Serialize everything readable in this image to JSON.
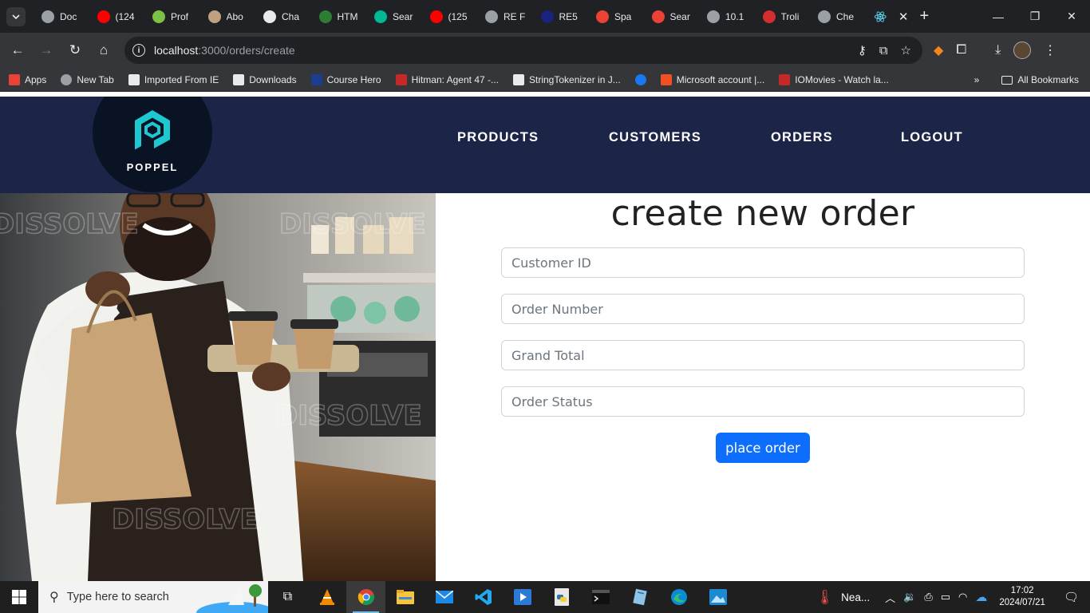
{
  "browser": {
    "tabs": [
      {
        "title": "Doc",
        "icon": "globe-icon",
        "color": "#9aa0a6"
      },
      {
        "title": "(124",
        "icon": "youtube-icon",
        "color": "#ff0000"
      },
      {
        "title": "Prof",
        "icon": "pen-icon",
        "color": "#7cc242"
      },
      {
        "title": "Abo",
        "icon": "avatar-icon",
        "color": "#c0a080"
      },
      {
        "title": "Cha",
        "icon": "chatgpt-icon",
        "color": "#e8eaed"
      },
      {
        "title": "HTM",
        "icon": "w-icon",
        "color": "#2e7d32"
      },
      {
        "title": "Sear",
        "icon": "v-icon",
        "color": "#00b894"
      },
      {
        "title": "(125",
        "icon": "youtube-icon",
        "color": "#ff0000"
      },
      {
        "title": "RE F",
        "icon": "globe-icon",
        "color": "#9aa0a6"
      },
      {
        "title": "RE5",
        "icon": "square-icon",
        "color": "#1a237e"
      },
      {
        "title": "Spa",
        "icon": "gmail-icon",
        "color": "#ea4335"
      },
      {
        "title": "Sear",
        "icon": "gmail-icon",
        "color": "#ea4335"
      },
      {
        "title": "10.1",
        "icon": "globe-icon",
        "color": "#9aa0a6"
      },
      {
        "title": "Troli",
        "icon": "shield-icon",
        "color": "#d32f2f"
      },
      {
        "title": "Che",
        "icon": "globe-icon",
        "color": "#9aa0a6"
      }
    ],
    "url_host": "localhost",
    "url_path": ":3000/orders/create",
    "bookmarks": [
      {
        "label": "Apps",
        "icon": "apps-grid-icon",
        "color": "#ea4335"
      },
      {
        "label": "New Tab",
        "icon": "globe-icon",
        "color": "#9aa0a6"
      },
      {
        "label": "Imported From IE",
        "icon": "folder-icon",
        "color": "#e8eaed"
      },
      {
        "label": "Downloads",
        "icon": "download-icon",
        "color": "#e8eaed"
      },
      {
        "label": "Course Hero",
        "icon": "star-icon",
        "color": "#1a3d8f"
      },
      {
        "label": "Hitman: Agent 47 -...",
        "icon": "io-icon",
        "color": "#c62828"
      },
      {
        "label": "StringTokenizer in J...",
        "icon": "t-icon",
        "color": "#e8eaed"
      },
      {
        "label": "",
        "icon": "facebook-icon",
        "color": "#1877f2"
      },
      {
        "label": "Microsoft account |...",
        "icon": "microsoft-icon",
        "color": "#f25022"
      },
      {
        "label": "IOMovies - Watch la...",
        "icon": "io-icon",
        "color": "#c62828"
      }
    ],
    "all_bookmarks": "All Bookmarks"
  },
  "site": {
    "logo_text": "POPPEL",
    "nav": [
      "PRODUCTS",
      "CUSTOMERS",
      "ORDERS",
      "LOGOUT"
    ]
  },
  "form": {
    "title": "create new order",
    "fields": [
      {
        "placeholder": "Customer ID",
        "value": ""
      },
      {
        "placeholder": "Order Number",
        "value": ""
      },
      {
        "placeholder": "Grand Total",
        "value": ""
      },
      {
        "placeholder": "Order Status",
        "value": ""
      }
    ],
    "submit_label": "place order"
  },
  "hero": {
    "watermark": "DISSOLVE"
  },
  "taskbar": {
    "search_placeholder": "Type here to search",
    "weather": "Nea...",
    "time": "17:02",
    "date": "2024/07/21"
  },
  "colors": {
    "header_bg": "#1c2448",
    "accent": "#0d6efd",
    "logo_teal": "#1ec8d0"
  }
}
